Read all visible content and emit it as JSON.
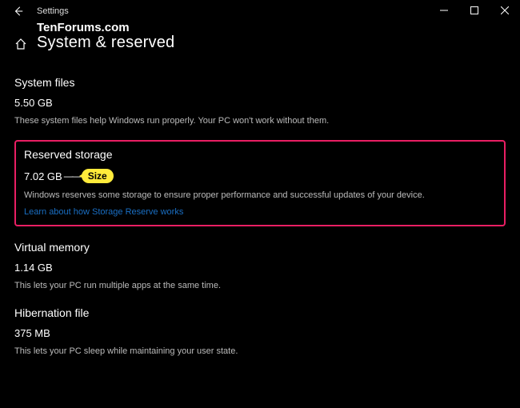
{
  "window": {
    "title": "Settings"
  },
  "watermark": "TenForums.com",
  "page": {
    "title": "System & reserved"
  },
  "sections": {
    "system_files": {
      "title": "System files",
      "value": "5.50 GB",
      "desc": "These system files help Windows run properly. Your PC won't work without them."
    },
    "reserved": {
      "title": "Reserved storage",
      "value": "7.02 GB",
      "callout": "Size",
      "desc": "Windows reserves some storage to ensure proper performance and successful updates of your device.",
      "link": "Learn about how Storage Reserve works"
    },
    "virtual_memory": {
      "title": "Virtual memory",
      "value": "1.14 GB",
      "desc": "This lets your PC run multiple apps at the same time."
    },
    "hibernation": {
      "title": "Hibernation file",
      "value": "375 MB",
      "desc": "This lets your PC sleep while maintaining your user state."
    }
  }
}
